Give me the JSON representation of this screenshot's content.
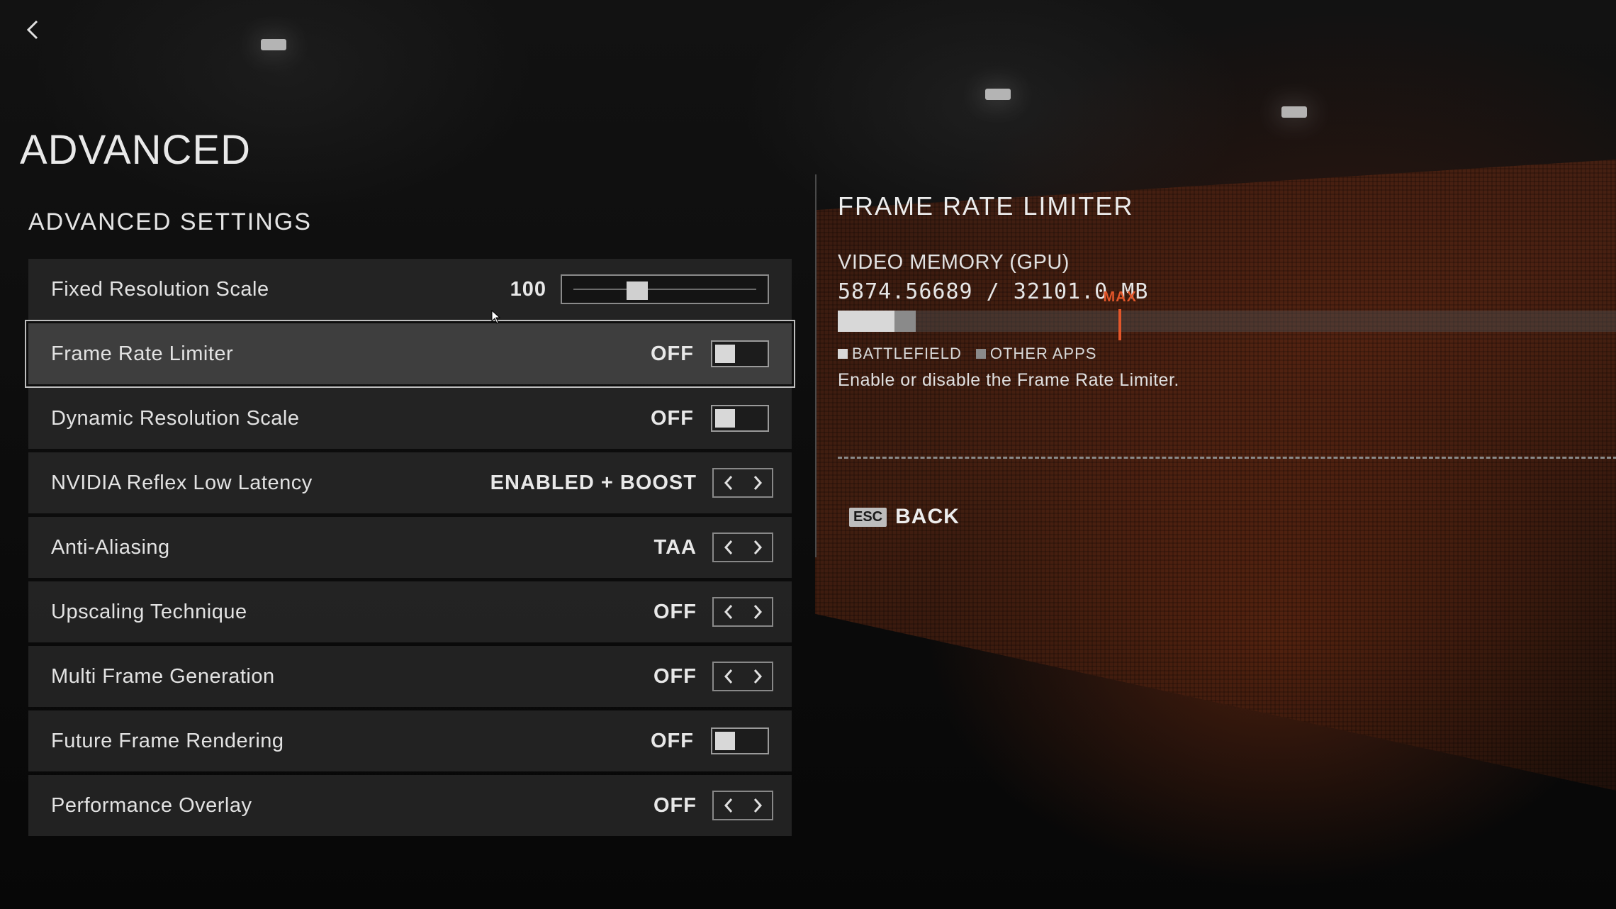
{
  "header": {
    "page_title": "ADVANCED",
    "section_title": "ADVANCED SETTINGS"
  },
  "settings": {
    "rows": [
      {
        "label": "Fixed Resolution Scale",
        "value": "100",
        "control": "slider",
        "slider_fraction": 0.35
      },
      {
        "label": "Frame Rate Limiter",
        "value": "OFF",
        "control": "toggle",
        "selected": true
      },
      {
        "label": "Dynamic Resolution Scale",
        "value": "OFF",
        "control": "toggle"
      },
      {
        "label": "NVIDIA Reflex Low Latency",
        "value": "ENABLED + BOOST",
        "control": "stepper"
      },
      {
        "label": "Anti-Aliasing",
        "value": "TAA",
        "control": "stepper"
      },
      {
        "label": "Upscaling Technique",
        "value": "OFF",
        "control": "stepper"
      },
      {
        "label": "Multi Frame Generation",
        "value": "OFF",
        "control": "stepper"
      },
      {
        "label": "Future Frame Rendering",
        "value": "OFF",
        "control": "toggle"
      },
      {
        "label": "Performance Overlay",
        "value": "OFF",
        "control": "stepper"
      }
    ]
  },
  "info_panel": {
    "title": "FRAME RATE LIMITER",
    "memory_label": "VIDEO MEMORY (GPU)",
    "memory_value": "5874.56689 / 32101.0 MB",
    "memory_bar": {
      "battlefield_fraction": 0.073,
      "other_apps_fraction": 0.027,
      "max_fraction": 0.362
    },
    "max_label": "MAX",
    "legend": {
      "battlefield": "BATTLEFIELD",
      "other_apps": "OTHER APPS"
    },
    "description": "Enable or disable the Frame Rate Limiter."
  },
  "footer": {
    "esc_key": "ESC",
    "back_label": "BACK"
  },
  "colors": {
    "accent_max": "#e2562a",
    "battlefield_swatch": "#d8d8d8",
    "other_apps_swatch": "#8a8a8a"
  },
  "icons": {
    "back": "chevron-left-icon",
    "prev": "chevron-left-icon",
    "next": "chevron-right-icon",
    "cursor": "mouse-cursor-icon"
  }
}
